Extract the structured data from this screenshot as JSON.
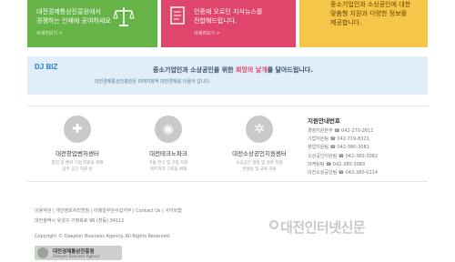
{
  "cards": [
    {
      "lines": [
        "대전경제통상진흥원에서",
        "경쟁하는 인재에 공여하세요"
      ],
      "more": "자세히보기 >"
    },
    {
      "lines": [
        "인증에 오로던 지식뉴스를",
        "전합해드립니다."
      ],
      "more": "자세히보기 >"
    },
    {
      "lines": [
        "중소기업인과 소상공인에 대한",
        "맞춤형 지원과 다양한 정보를",
        "제공합니다."
      ],
      "more": "자세히보기 >"
    }
  ],
  "banner": {
    "logo_a": "DJ ",
    "logo_b": "BIZ",
    "main_before": "중소기업인과 소상공인을 위한 ",
    "main_highlight": "희망의 날개",
    "main_after": "를 달아드립니다.",
    "sub": "대전경제통상진흥원은 미래지향적 대전경제를 이끌어 갑니다."
  },
  "centers": [
    {
      "icon": "✚",
      "title": "대전창업벤처센터",
      "desc": [
        "창업 및 벤처 기업 지원을 위해",
        "입주 공간 지원 등"
      ]
    },
    {
      "icon": "◉",
      "title": "대전테크노파크",
      "desc": [
        "기술 연구 및 기업 지원",
        "네트워크 구축을 위해"
      ]
    },
    {
      "icon": "✲",
      "title": "대전소상공인지원센터",
      "desc": [
        "소상공인 창업 및 경영 지원",
        "컨설팅 및 교육 지원"
      ]
    }
  ],
  "contacts": {
    "title": "지원안내번호",
    "rows": [
      "경영지원본부 ☎ 042-270-2611",
      "기업지원팀 ☎ 042-719-8321",
      "창업지원팀 ☎ 042-380-3081",
      "소상공인지원팀 ☎ 042-380-3082",
      "마케팅팀 ☎ 042-380-3083",
      "대전소상공인팀 ☎ 042-380-0114"
    ]
  },
  "footer": {
    "links": "이용약관 | 개인정보처리방침 | 이메일무단수집거부 | Contact Us | 사이트맵",
    "address": "대전광역시 유성구 가정북로 96 (장동) 34111",
    "copyright": "Copyright © Daejeon Business Agency. All Rights Reserved.",
    "logo_name": "대전경제통상진흥원",
    "logo_sub": "Daejeon Business Agency"
  },
  "watermark": "대전인터넷신문"
}
